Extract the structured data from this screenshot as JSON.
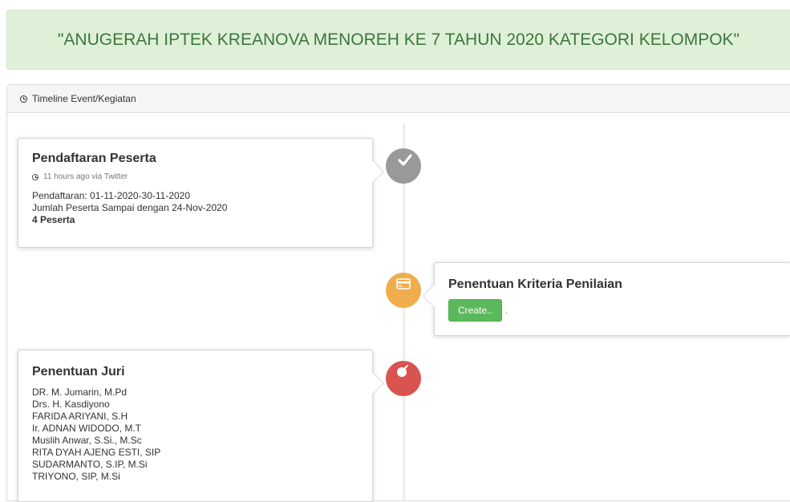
{
  "banner": {
    "title": "\"ANUGERAH IPTEK KREANOVA MENOREH KE 7 TAHUN 2020 KATEGORI KELOMPOK\""
  },
  "panel": {
    "heading": "Timeline Event/Kegiatan"
  },
  "timeline": [
    {
      "title": "Pendaftaran Peserta",
      "meta": "11 hours ago via Twitter",
      "lines": [
        "Pendaftaran: 01-11-2020-30-11-2020",
        "Jumlah Peserta Sampai dengan 24-Nov-2020"
      ],
      "bold": "4 Peserta",
      "badge_color": "#999999",
      "badge_icon": "check-icon"
    },
    {
      "title": "Penentuan Kriteria Penilaian",
      "button": "Create..",
      "after_button": ".",
      "badge_color": "#f0ad4e",
      "badge_icon": "credit-card-icon"
    },
    {
      "title": "Penentuan Juri",
      "juri": [
        "DR. M. Jumarin, M.Pd",
        "Drs. H. Kasdiyono",
        "FARIDA ARIYANI, S.H",
        "Ir. ADNAN WIDODO, M.T",
        "Muslih Anwar, S.Si., M.Sc",
        "RITA DYAH AJENG ESTI, SIP",
        "SUDARMANTO, S.IP, M.Si",
        "TRIYONO, SIP, M.Si"
      ],
      "badge_color": "#d9534f",
      "badge_icon": "bomb-icon"
    }
  ]
}
